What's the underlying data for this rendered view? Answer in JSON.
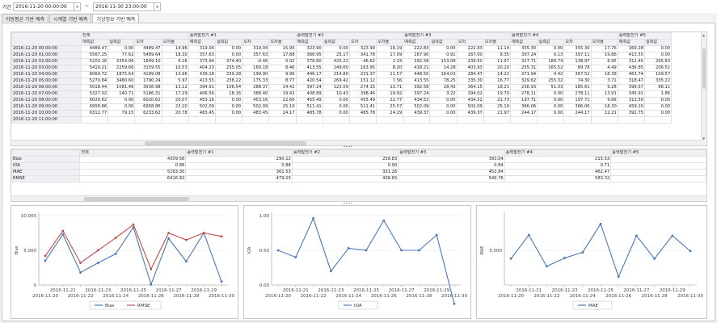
{
  "toolbar": {
    "period_label": "기간",
    "start": "2016-11-20 00:00:00",
    "tilde": "~",
    "end": "2016-11-30 23:00:00"
  },
  "tabs": [
    "이동평균 기반 예측",
    "시계열 기반 예측",
    "기상정보 기반 예측"
  ],
  "top_grid": {
    "groups": [
      "전체",
      "풍력발전기 #1",
      "풍력발전기 #2",
      "풍력발전기 #3",
      "풍력발전기 #4",
      "풍력발전기 #5"
    ],
    "subheaders": [
      "예측값",
      "실측값",
      "오차",
      "오차율"
    ],
    "rows": [
      {
        "time": "2016-11-20 00:00:00",
        "v": [
          "4489.47",
          "0.00",
          "4489.47",
          "14.96",
          "319.04",
          "0.00",
          "319.04",
          "15.95",
          "323.90",
          "0.00",
          "323.90",
          "16.19",
          "222.83",
          "0.00",
          "222.83",
          "11.14",
          "355.30",
          "0.00",
          "355.30",
          "17.76",
          "369.28",
          "0.00",
          "369.2"
        ]
      },
      {
        "time": "2016-11-20 01:00:00",
        "v": [
          "5567.25",
          "77.62",
          "5489.64",
          "18.30",
          "357.63",
          "0.00",
          "357.63",
          "17.88",
          "366.95",
          "25.17",
          "341.78",
          "17.09",
          "167.90",
          "0.91",
          "167.00",
          "8.35",
          "397.24",
          "0.13",
          "397.11",
          "19.86",
          "413.55",
          "0.00",
          "413.5"
        ]
      },
      {
        "time": "2016-11-20 02:00:00",
        "v": [
          "5203.16",
          "3354.06",
          "1849.10",
          "6.16",
          "373.94",
          "374.40",
          "-0.46",
          "0.02",
          "378.60",
          "425.22",
          "-46.62",
          "2.33",
          "392.58",
          "153.08",
          "239.50",
          "11.97",
          "327.71",
          "188.74",
          "138.97",
          "6.95",
          "312.45",
          "295.83",
          "16.6"
        ]
      },
      {
        "time": "2016-11-20 03:00:00",
        "v": [
          "5419.21",
          "2259.66",
          "3159.55",
          "10.53",
          "404.23",
          "235.05",
          "169.18",
          "8.46",
          "413.55",
          "249.60",
          "163.95",
          "8.20",
          "418.21",
          "14.28",
          "403.93",
          "20.20",
          "255.31",
          "165.52",
          "89.78",
          "4.49",
          "436.85",
          "206.51",
          "230.3"
        ]
      },
      {
        "time": "2016-11-20 04:00:00",
        "v": [
          "6064.72",
          "1875.64",
          "4189.08",
          "13.96",
          "439.18",
          "239.28",
          "199.90",
          "9.99",
          "446.17",
          "214.80",
          "231.37",
          "11.57",
          "448.50",
          "164.03",
          "284.47",
          "14.22",
          "371.94",
          "4.42",
          "367.52",
          "18.38",
          "463.74",
          "109.57",
          "354.1"
        ]
      },
      {
        "time": "2016-11-20 05:00:00",
        "v": [
          "5270.84",
          "3480.60",
          "1790.24",
          "5.97",
          "413.55",
          "238.22",
          "175.33",
          "8.77",
          "420.54",
          "269.42",
          "151.12",
          "7.56",
          "413.55",
          "78.25",
          "335.30",
          "16.77",
          "329.62",
          "255.32",
          "74.30",
          "3.71",
          "318.47",
          "335.22",
          "-16.7"
        ]
      },
      {
        "time": "2016-11-20 06:00:00",
        "v": [
          "5018.44",
          "1081.46",
          "3936.98",
          "13.12",
          "394.91",
          "106.54",
          "288.37",
          "14.42",
          "397.24",
          "123.09",
          "274.15",
          "13.71",
          "392.58",
          "28.43",
          "364.15",
          "18.21",
          "236.93",
          "51.33",
          "185.61",
          "9.28",
          "399.57",
          "68.11",
          "331.4"
        ]
      },
      {
        "time": "2016-11-20 07:00:00",
        "v": [
          "5327.02",
          "140.71",
          "5186.31",
          "17.29",
          "406.56",
          "18.16",
          "388.40",
          "19.42",
          "408.89",
          "10.43",
          "398.46",
          "19.92",
          "397.24",
          "3.22",
          "394.02",
          "19.70",
          "278.11",
          "0.00",
          "278.11",
          "13.91",
          "345.91",
          "1.86",
          "344.0"
        ]
      },
      {
        "time": "2016-11-20 08:00:00",
        "v": [
          "6020.62",
          "0.00",
          "6020.62",
          "20.07",
          "453.16",
          "0.00",
          "453.16",
          "22.66",
          "455.49",
          "0.00",
          "455.49",
          "22.77",
          "434.52",
          "0.00",
          "434.52",
          "21.73",
          "197.71",
          "0.00",
          "197.71",
          "9.89",
          "313.50",
          "0.00",
          "313.5"
        ]
      },
      {
        "time": "2016-11-20 09:00:00",
        "v": [
          "6958.86",
          "0.00",
          "6958.86",
          "23.20",
          "502.09",
          "0.00",
          "502.09",
          "25.10",
          "511.41",
          "0.00",
          "511.41",
          "25.57",
          "502.09",
          "0.00",
          "502.09",
          "25.10",
          "366.06",
          "0.00",
          "366.06",
          "18.30",
          "459.10",
          "0.00",
          "459.1"
        ]
      },
      {
        "time": "2016-11-20 10:00:00",
        "v": [
          "6312.77",
          "79.15",
          "6233.62",
          "20.78",
          "483.45",
          "0.00",
          "483.45",
          "24.17",
          "485.78",
          "0.00",
          "485.78",
          "24.29",
          "439.37",
          "0.00",
          "439.37",
          "21.97",
          "244.17",
          "0.00",
          "244.17",
          "12.21",
          "392.75",
          "0.00",
          "392.7"
        ]
      },
      {
        "time": "2016-11-20 11:00:00",
        "v": []
      }
    ]
  },
  "bottom_grid": {
    "groups": [
      "전체",
      "풍력발전기 #1",
      "풍력발전기 #2",
      "풍력발전기 #3",
      "풍력발전기 #4",
      "풍력발전기 #5"
    ],
    "rows": [
      {
        "metric": "Bias",
        "v": [
          "4309.58",
          "290.12",
          "256.83",
          "393.04",
          "215.53"
        ]
      },
      {
        "metric": "IOA",
        "v": [
          "0.88",
          "0.88",
          "0.90",
          "0.84",
          "0.71"
        ]
      },
      {
        "metric": "MAE",
        "v": [
          "5163.30",
          "361.53",
          "331.26",
          "452.84",
          "462.47"
        ]
      },
      {
        "metric": "RMSE",
        "v": [
          "6416.82",
          "479.03",
          "438.65",
          "549.76",
          "583.32"
        ]
      }
    ]
  },
  "chart_data": [
    {
      "type": "line",
      "x": [
        "2016-11-20",
        "2016-11-21",
        "2016-11-22",
        "2016-11-23",
        "2016-11-24",
        "2016-11-25",
        "2016-11-26",
        "2016-11-27",
        "2016-11-28",
        "2016-11-29",
        "2016-11-30"
      ],
      "xticks_upper": [
        "2016-11-21",
        "2016-11-23",
        "2016-11-25",
        "2016-11-27",
        "2016-11-29"
      ],
      "xticks_lower": [
        "2016-11-20",
        "2016-11-22",
        "2016-11-24",
        "2016-11-26",
        "2016-11-28",
        "2016-11-30"
      ],
      "ylabel": "Bias",
      "ylim": [
        0,
        10000
      ],
      "yticks": [
        "10,000",
        "5,000",
        "0"
      ],
      "series": [
        {
          "name": "Bias",
          "color": "#4a78b5",
          "values": [
            3500,
            7300,
            1800,
            3200,
            4500,
            8300,
            100,
            6700,
            3400,
            7500,
            500
          ]
        },
        {
          "name": "RMSE",
          "color": "#c0504d",
          "values": [
            4200,
            7800,
            3200,
            5000,
            6800,
            8700,
            2300,
            7500,
            6500,
            7500,
            7000
          ]
        }
      ],
      "legend": "bottom"
    },
    {
      "type": "line",
      "x": [
        "2016-11-20",
        "2016-11-21",
        "2016-11-22",
        "2016-11-23",
        "2016-11-24",
        "2016-11-25",
        "2016-11-26",
        "2016-11-27",
        "2016-11-28",
        "2016-11-29",
        "2016-11-30"
      ],
      "xticks_upper": [
        "2016-11-21",
        "2016-11-23",
        "2016-11-25",
        "2016-11-27",
        "2016-11-29"
      ],
      "xticks_lower": [
        "2016-11-20",
        "2016-11-22",
        "2016-11-24",
        "2016-11-26",
        "2016-11-28",
        "2016-11-30"
      ],
      "ylabel": "IOA",
      "ylim": [
        0,
        1
      ],
      "yticks": [
        "1.00",
        "0.50",
        "0.00"
      ],
      "series": [
        {
          "name": "IOA",
          "color": "#4a78b5",
          "values": [
            0.5,
            0.4,
            0.96,
            0.2,
            0.53,
            0.5,
            0.93,
            0.5,
            0.5,
            0.72,
            -0.27
          ]
        }
      ],
      "legend": "bottom"
    },
    {
      "type": "line",
      "x": [
        "2016-11-20",
        "2016-11-21",
        "2016-11-22",
        "2016-11-23",
        "2016-11-24",
        "2016-11-25",
        "2016-11-26",
        "2016-11-27",
        "2016-11-28",
        "2016-11-29",
        "2016-11-30"
      ],
      "xticks_upper": [
        "2016-11-21",
        "2016-11-23",
        "2016-11-25",
        "2016-11-27",
        "2016-11-29"
      ],
      "xticks_lower": [
        "2016-11-20",
        "2016-11-22",
        "2016-11-24",
        "2016-11-26",
        "2016-11-28",
        "2016-11-30"
      ],
      "ylabel": "MAE",
      "yticks": [
        "5,000"
      ],
      "ylim": [
        0,
        10000
      ],
      "series": [
        {
          "name": "MAE",
          "color": "#4a78b5",
          "values": [
            3800,
            7200,
            2700,
            3900,
            4700,
            8800,
            1200,
            7100,
            3800,
            7100,
            4900
          ]
        }
      ],
      "legend": "bottom"
    }
  ]
}
